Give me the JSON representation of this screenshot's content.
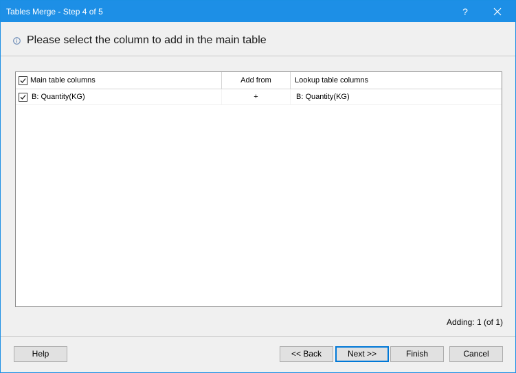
{
  "window": {
    "title": "Tables Merge - Step 4 of 5",
    "help_glyph": "?",
    "title_color": "#1d8fe6"
  },
  "header": {
    "text": "Please select the column to add in the main table",
    "icon": "info-icon"
  },
  "grid": {
    "columns": {
      "main": "Main table columns",
      "add_from": "Add from",
      "lookup": "Lookup table columns"
    },
    "header_checked": true,
    "rows": [
      {
        "checked": true,
        "main": "B: Quantity(KG)",
        "add_from": "+",
        "lookup": "B: Quantity(KG)"
      }
    ]
  },
  "status": {
    "adding": "Adding: 1 (of 1)"
  },
  "buttons": {
    "help": "Help",
    "back": "<< Back",
    "next": "Next >>",
    "finish": "Finish",
    "cancel": "Cancel"
  }
}
